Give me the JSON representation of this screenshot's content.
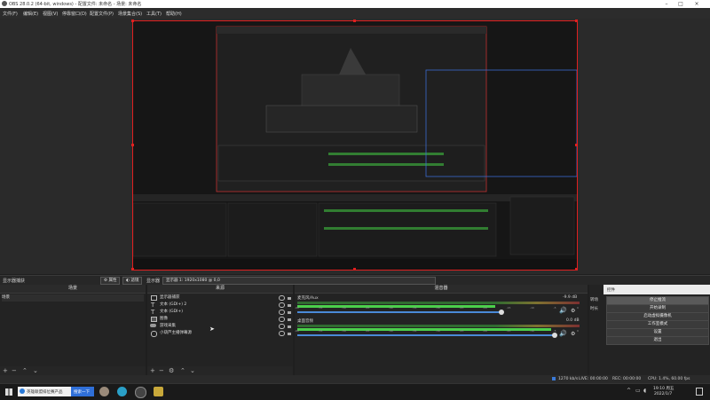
{
  "window": {
    "title": "OBS 28.0.2 (64-bit, windows) - 配置文件: 未命名 - 场景: 未命名"
  },
  "menu": [
    {
      "label": "文件(F)"
    },
    {
      "label": "编辑(E)"
    },
    {
      "label": "视图(V)"
    },
    {
      "label": "停靠窗口(D)"
    },
    {
      "label": "配置文件(P)"
    },
    {
      "label": "场景集合(S)"
    },
    {
      "label": "工具(T)"
    },
    {
      "label": "帮助(H)"
    }
  ],
  "source_bar": {
    "selected_source": "显示器捕获",
    "properties": "属性",
    "filters": "滤镜",
    "display_label": "显示器",
    "display_value": "显示器 1: 1920x1080 @ 0,0"
  },
  "scenes": {
    "title": "场景",
    "items": [
      "场景"
    ]
  },
  "sources": {
    "title": "来源",
    "items": [
      {
        "label": "显示器捕获",
        "icon": "monitor-icon"
      },
      {
        "label": "文本 (GDI+) 2",
        "icon": "text-icon"
      },
      {
        "label": "文本 (GDI+)",
        "icon": "text-icon"
      },
      {
        "label": "图像",
        "icon": "image-icon"
      },
      {
        "label": "游戏采集",
        "icon": "gamepad-icon"
      },
      {
        "label": "小葫芦主播弹幕源",
        "icon": "browser-icon"
      }
    ]
  },
  "mixer": {
    "title": "混音器",
    "channels": [
      {
        "name": "麦克风/Aux",
        "db": "-9.9 dB",
        "level": 0.7
      },
      {
        "name": "桌面音频",
        "db": "0.0 dB",
        "level": 0.9
      }
    ],
    "ticks": [
      "-60",
      "-55",
      "-50",
      "-45",
      "-40",
      "-35",
      "-30",
      "-25",
      "-20",
      "-15",
      "-10",
      "-5",
      "0"
    ]
  },
  "transitions": {
    "tab_a": "转场",
    "tab_b": "时长"
  },
  "controls": {
    "title": "控件",
    "buttons": [
      "停止推流",
      "开始录制",
      "启动虚拟摄像机",
      "工作室模式",
      "设置",
      "退出"
    ]
  },
  "status": {
    "live": "LIVE: 00:00:00",
    "rec": "REC: 00:00:00",
    "cpu": "CPU: 1.4%, 60.00 fps",
    "kbps": "1270 kb/s"
  },
  "taskbar": {
    "search_text": "英雄联盟排位赛产品",
    "search_button": "搜索一下",
    "time": "19:10 周五",
    "date": "2022/1/7"
  },
  "colors": {
    "accent": "#e02020",
    "meter_green": "#4bd04b",
    "slider_blue": "#4a8ad8"
  }
}
